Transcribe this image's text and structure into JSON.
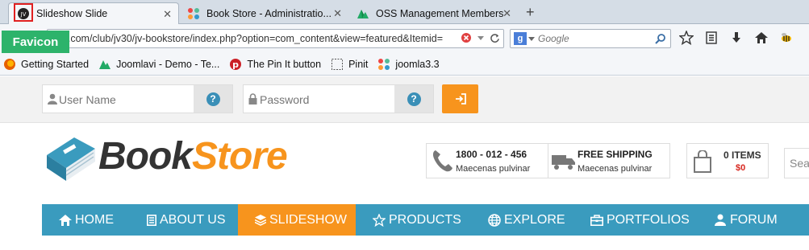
{
  "browser": {
    "tabs": [
      {
        "title": "Slideshow Slide",
        "active": true
      },
      {
        "title": "Book Store - Administratio...",
        "active": false
      },
      {
        "title": "OSS Management Members",
        "active": false
      }
    ],
    "new_tab_label": "+",
    "url": "ao2.com/club/jv30/jv-bookstore/index.php?option=com_content&view=featured&Itemid=",
    "search_placeholder": "Google",
    "bookmarks": [
      {
        "label": "Getting Started",
        "icon": "firefox-icon"
      },
      {
        "label": "Joomlavi - Demo - Te...",
        "icon": "joomlavi-icon"
      },
      {
        "label": "The Pin It button",
        "icon": "pinterest-icon"
      },
      {
        "label": "Pinit",
        "icon": "pinit-icon"
      },
      {
        "label": "joomla3.3",
        "icon": "joomla-icon"
      }
    ]
  },
  "annotation": {
    "label": "Favicon",
    "color": "#2db36b",
    "box_color": "#e02020"
  },
  "login": {
    "username_placeholder": "User Name",
    "password_placeholder": "Password",
    "help_label": "?"
  },
  "header": {
    "logo_part1": "Book",
    "logo_part2": "Store",
    "phone": {
      "title": "1800 - 012 - 456",
      "subtitle": "Maecenas pulvinar"
    },
    "shipping": {
      "title": "FREE SHIPPING",
      "subtitle": "Maecenas pulvinar"
    },
    "cart": {
      "items": "0 ITEMS",
      "total": "$0"
    },
    "search_placeholder": "Sea"
  },
  "nav": [
    {
      "label": "HOME",
      "icon": "home-icon",
      "active": false
    },
    {
      "label": "ABOUT US",
      "icon": "document-icon",
      "active": false
    },
    {
      "label": "SLIDESHOW",
      "icon": "layers-icon",
      "active": true
    },
    {
      "label": "PRODUCTS",
      "icon": "star-icon",
      "active": false
    },
    {
      "label": "EXPLORE",
      "icon": "globe-icon",
      "active": false
    },
    {
      "label": "PORTFOLIOS",
      "icon": "briefcase-icon",
      "active": false
    },
    {
      "label": "FORUM",
      "icon": "users-icon",
      "active": false
    }
  ],
  "colors": {
    "accent": "#f7941d",
    "nav": "#3a9bbe",
    "dark": "#333333"
  }
}
